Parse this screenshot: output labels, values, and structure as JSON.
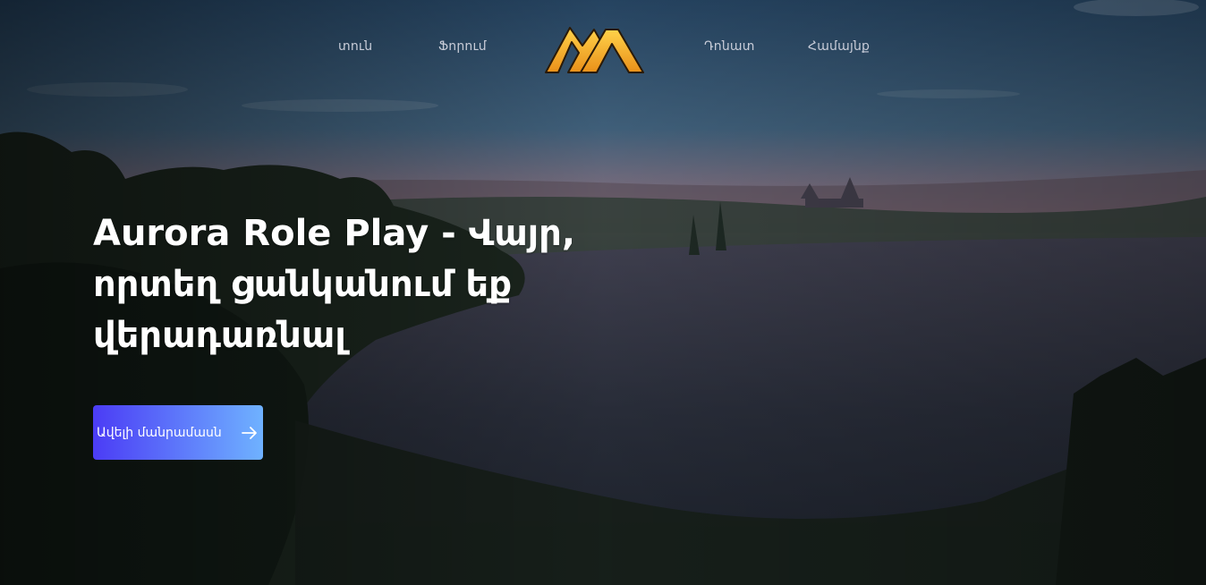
{
  "nav": {
    "items": [
      {
        "label": "տուն"
      },
      {
        "label": "Ֆորում"
      },
      {
        "label": "Դոնատ"
      },
      {
        "label": "Համայնք"
      }
    ],
    "logo_icon": "mountain-logo-icon",
    "link_color": "#c8ccd8"
  },
  "hero": {
    "title": "Aurora Role Play - Վայր, որտեղ ցանկանում եք վերադառնալ",
    "cta_label": "Ավելի մանրամասն",
    "cta_icon": "arrow-right-icon"
  },
  "colors": {
    "logo_gold": "#f5a623",
    "cta_start": "#4b3cf5",
    "cta_end": "#6fb2ff"
  }
}
